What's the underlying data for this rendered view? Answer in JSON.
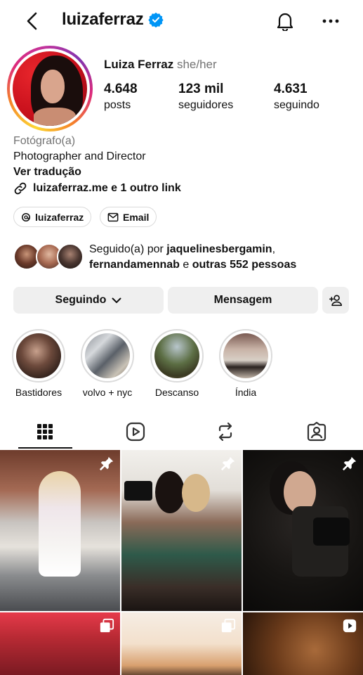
{
  "header": {
    "username": "luizaferraz"
  },
  "profile": {
    "full_name": "Luiza Ferraz",
    "pronouns": "she/her",
    "stats": [
      {
        "value": "4.648",
        "label": "posts"
      },
      {
        "value": "123 mil",
        "label": "seguidores"
      },
      {
        "value": "4.631",
        "label": "seguindo"
      }
    ],
    "category": "Fotógrafo(a)",
    "bio": "Photographer and Director",
    "translate_label": "Ver tradução",
    "link_text": "luizaferraz.me e 1 outro link",
    "chips": [
      {
        "label": "luizaferraz",
        "icon": "threads-icon"
      },
      {
        "label": "Email",
        "icon": "mail-icon"
      }
    ]
  },
  "followed_by": {
    "prefix": "Seguido(a) por ",
    "user1": "jaquelinesbergamin",
    "sep": ",",
    "user2": "fernandamennab",
    "middle": " e ",
    "others": "outras 552 pessoas"
  },
  "actions": {
    "following": "Seguindo",
    "message": "Mensagem"
  },
  "highlights": [
    {
      "label": "Bastidores"
    },
    {
      "label": "volvo + nyc"
    },
    {
      "label": "Descanso"
    },
    {
      "label": "Índia"
    }
  ],
  "tabs": [
    "grid-icon",
    "reels-icon",
    "reposts-icon",
    "tagged-icon"
  ],
  "colors": {
    "verified": "#0095f6",
    "button_bg": "#efefef",
    "muted": "#737373"
  }
}
